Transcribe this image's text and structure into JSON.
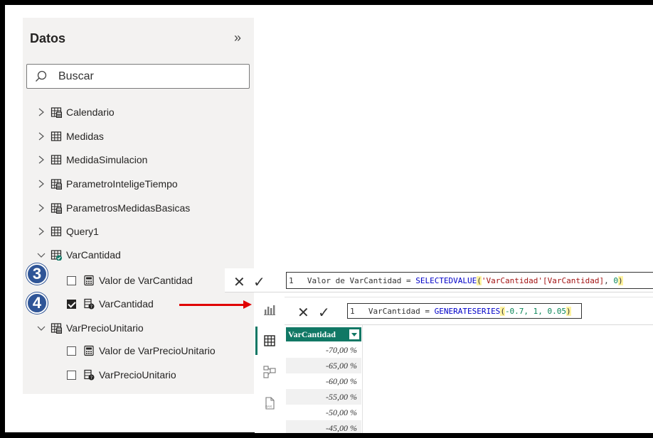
{
  "data_pane": {
    "title": "Datos",
    "collapse_glyph": "»",
    "search_placeholder": "Buscar",
    "tables": [
      {
        "name": "Calendario",
        "icon": "calculated-table-icon",
        "expanded": false
      },
      {
        "name": "Medidas",
        "icon": "table-icon",
        "expanded": false
      },
      {
        "name": "MedidaSimulacion",
        "icon": "table-icon",
        "expanded": false
      },
      {
        "name": "ParametroInteligeTiempo",
        "icon": "calculated-table-icon",
        "expanded": false
      },
      {
        "name": "ParametrosMedidasBasicas",
        "icon": "calculated-table-icon",
        "expanded": false
      },
      {
        "name": "Query1",
        "icon": "table-icon",
        "expanded": false
      },
      {
        "name": "VarCantidad",
        "icon": "parameter-table-icon",
        "expanded": true
      },
      {
        "name": "VarPrecioUnitario",
        "icon": "calculated-table-icon",
        "expanded": true
      }
    ],
    "varcantidad_fields": [
      {
        "name": "Valor de VarCantidad",
        "checked": false,
        "icon": "measure-icon"
      },
      {
        "name": "VarCantidad",
        "checked": true,
        "icon": "parameter-column-icon"
      }
    ],
    "varpreciounitario_fields": [
      {
        "name": "Valor de VarPrecioUnitario",
        "checked": false,
        "icon": "measure-icon"
      },
      {
        "name": "VarPrecioUnitario",
        "checked": false,
        "icon": "parameter-column-icon"
      }
    ]
  },
  "callouts": {
    "step3": "3",
    "step4": "4"
  },
  "formula_bar_1": {
    "cancel": "✕",
    "commit": "✓",
    "line_number": "1",
    "code_prefix": "Valor de VarCantidad = ",
    "code_fn": "SELECTEDVALUE",
    "code_paren": "(",
    "code_arg": "'VarCantidad'[VarCantidad]",
    "code_sep": ", ",
    "code_default": "0",
    "code_close": ")"
  },
  "formula_bar_2": {
    "cancel": "✕",
    "commit": "✓",
    "line_number": "1",
    "code_prefix": "VarCantidad = ",
    "code_fn": "GENERATESERIES",
    "code_paren": "(",
    "code_args": "-0.7, 1, 0.05",
    "code_close": ")"
  },
  "views": [
    "report-view-icon",
    "table-view-icon",
    "model-view-icon",
    "dax-query-view-icon"
  ],
  "table_view": {
    "column_header": "VarCantidad",
    "rows": [
      "-70,00 %",
      "-65,00 %",
      "-60,00 %",
      "-55,00 %",
      "-50,00 %",
      "-45,00 %"
    ]
  },
  "colors": {
    "pane_bg": "#f3f2f1",
    "accent_teal": "#117865",
    "badge_blue": "#2f5597",
    "arrow_red": "#e00000"
  }
}
